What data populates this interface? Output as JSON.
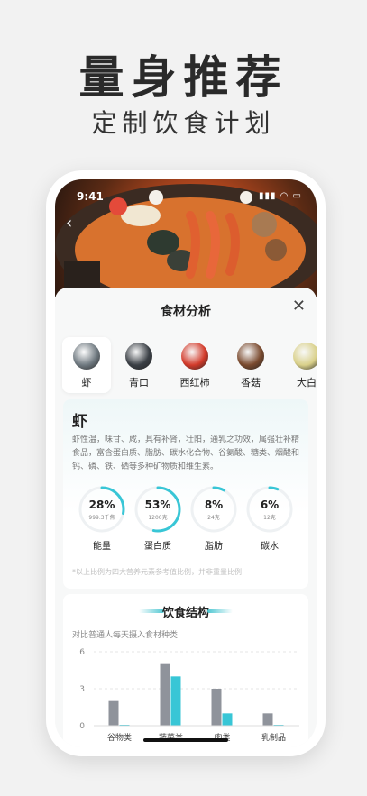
{
  "hero": {
    "title": "量身推荐",
    "subtitle": "定制饮食计划"
  },
  "status": {
    "time": "9:41",
    "icons": "▮▮▮ ◠ ▭"
  },
  "sheet": {
    "title": "食材分析"
  },
  "foods": [
    {
      "label": "虾",
      "icon": "shrimp-thumb",
      "color": "#6f7980",
      "active": true
    },
    {
      "label": "青口",
      "icon": "mussel-thumb",
      "color": "#3a3f45",
      "active": false
    },
    {
      "label": "西红柿",
      "icon": "tomato-thumb",
      "color": "#d23a2a",
      "active": false
    },
    {
      "label": "香菇",
      "icon": "mushroom-thumb",
      "color": "#7a4a2e",
      "active": false
    },
    {
      "label": "大白",
      "icon": "cabbage-thumb",
      "color": "#d9d08a",
      "active": false
    }
  ],
  "analysis": {
    "name": "虾",
    "description": "虾性温，味甘、咸，具有补肾，壮阳，通乳之功效，属强壮补精食品，富含蛋白质、脂肪、碳水化合物、谷氨酸、糖类、烟酸和钙、磷、铁、硒等多种矿物质和维生素。",
    "nutrients": [
      {
        "pct": "28%",
        "amount": "999.3千焦",
        "label": "能量",
        "fraction": 0.28
      },
      {
        "pct": "53%",
        "amount": "1200克",
        "label": "蛋白质",
        "fraction": 0.53
      },
      {
        "pct": "8%",
        "amount": "24克",
        "label": "脂肪",
        "fraction": 0.08
      },
      {
        "pct": "6%",
        "amount": "12克",
        "label": "碳水",
        "fraction": 0.06
      }
    ],
    "note": "*以上比例为四大营养元素参考值比例，并非重量比例"
  },
  "diet": {
    "title": "饮食结构",
    "subtitle": "对比普通人每天摄入食材种类"
  },
  "chart_data": {
    "type": "bar",
    "categories": [
      "谷物类",
      "蔬菜类",
      "肉类",
      "乳制品"
    ],
    "series": [
      {
        "values": [
          2,
          5,
          3,
          1
        ],
        "color": "#8f939b"
      },
      {
        "values": [
          0,
          4,
          1,
          0
        ],
        "color": "#38c6d6"
      }
    ],
    "yticks": [
      "0",
      "3",
      "6"
    ],
    "ylim": [
      0,
      6
    ],
    "grid": true
  },
  "colors": {
    "accent": "#38c6d6",
    "ringTrack": "#eef1f3"
  }
}
